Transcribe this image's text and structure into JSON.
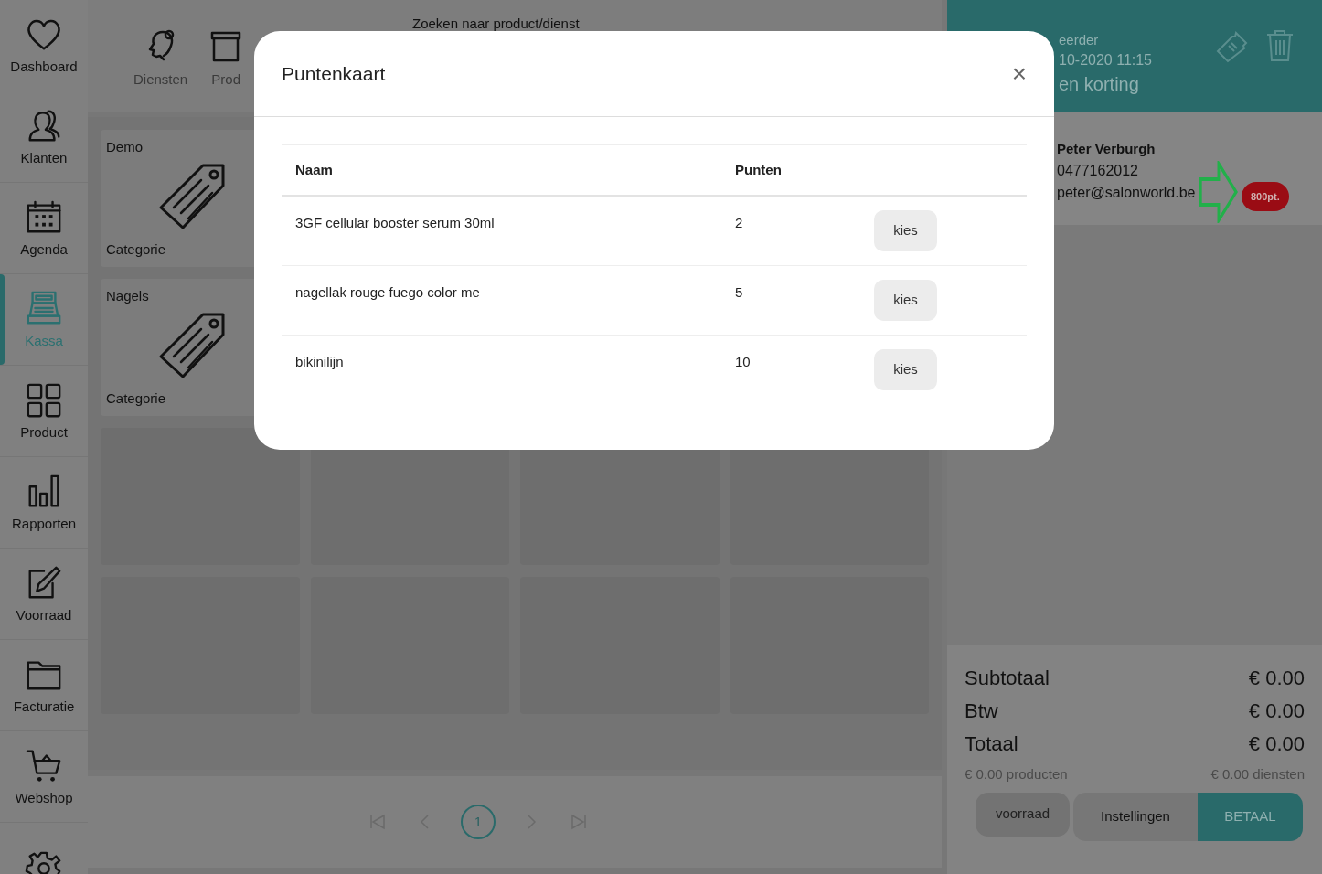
{
  "sidebar": {
    "items": [
      {
        "label": "Dashboard",
        "selected": false
      },
      {
        "label": "Klanten",
        "selected": false
      },
      {
        "label": "Agenda",
        "selected": false
      },
      {
        "label": "Kassa",
        "selected": true
      },
      {
        "label": "Product",
        "selected": false
      },
      {
        "label": "Rapporten",
        "selected": false
      },
      {
        "label": "Voorraad",
        "selected": false
      },
      {
        "label": "Facturatie",
        "selected": false
      },
      {
        "label": "Webshop",
        "selected": false
      },
      {
        "selected": false
      }
    ]
  },
  "toolbar": {
    "search_label": "Zoeken naar product/dienst",
    "tabs": [
      {
        "label": "Diensten"
      },
      {
        "label": "Prod"
      }
    ]
  },
  "tiles": [
    {
      "title": "Demo",
      "subtitle": "Categorie"
    },
    {
      "title": "Nagels",
      "subtitle": "Categorie"
    }
  ],
  "pagination": {
    "pages": [
      {
        "label": "1",
        "selected": true
      }
    ]
  },
  "order": {
    "lines": [
      "eerder",
      "10-2020 11:15",
      "en korting"
    ]
  },
  "customer": {
    "name": "Peter Verburgh",
    "phone": "0477162012",
    "email": "peter@salonworld.be",
    "points_badge": "800pt."
  },
  "totals": {
    "rows": [
      {
        "label": "Subtotaal",
        "value": "€ 0.00"
      },
      {
        "label": "Btw",
        "value": "€ 0.00"
      },
      {
        "label": "Totaal",
        "value": "€ 0.00"
      }
    ],
    "split": [
      "€ 0.00 producten",
      "€ 0.00 diensten"
    ],
    "buttons": [
      {
        "label": "voorraad",
        "kind": "plain"
      },
      {
        "label": "Instellingen",
        "kind": "group"
      },
      {
        "label": "BETAAL",
        "kind": "primary"
      }
    ]
  },
  "modal": {
    "title": "Puntenkaart",
    "close": "×",
    "columns": [
      "Naam",
      "Punten"
    ],
    "rows": [
      {
        "name": "3GF cellular booster serum 30ml",
        "points": "2",
        "action": "kies"
      },
      {
        "name": "nagellak rouge fuego color me",
        "points": "5",
        "action": "kies"
      },
      {
        "name": "bikinilijn",
        "points": "10",
        "action": "kies"
      }
    ]
  }
}
